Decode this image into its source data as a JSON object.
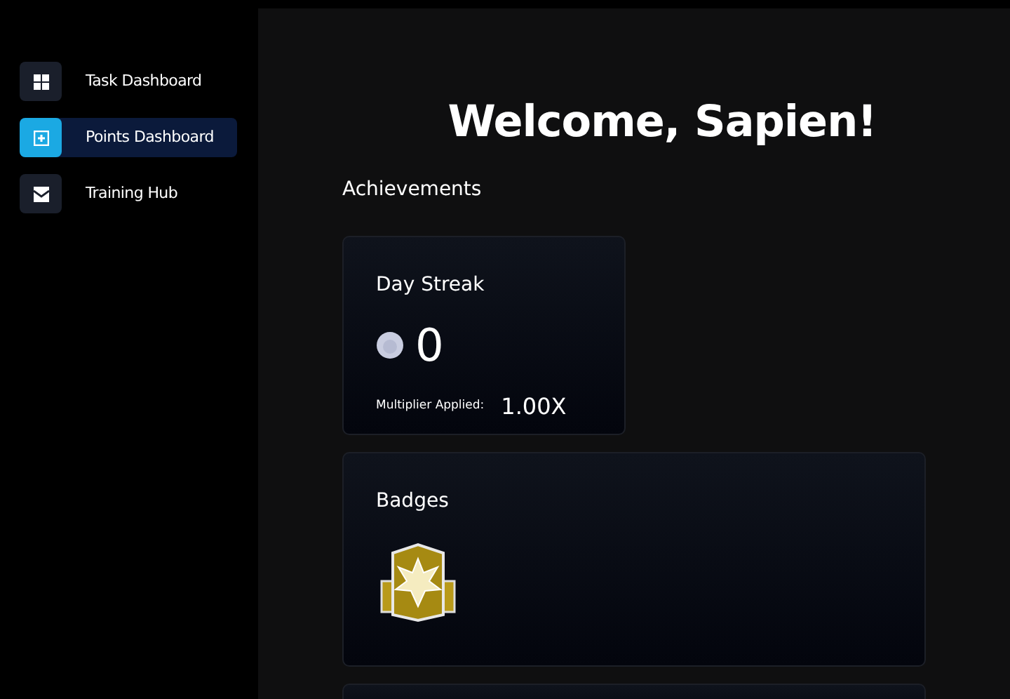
{
  "sidebar": {
    "items": [
      {
        "label": "Task Dashboard",
        "kind": "grid",
        "selected": false
      },
      {
        "label": "Points Dashboard",
        "kind": "points",
        "selected": true
      },
      {
        "label": "Training Hub",
        "kind": "training",
        "selected": false
      }
    ]
  },
  "main": {
    "title": "Welcome, Sapien!",
    "section_title": "Achievements",
    "day_streak": {
      "title": "Day Streak",
      "value": "0",
      "multiplier_label": "Multiplier Applied:",
      "multiplier_value": "1.00X"
    },
    "badges": {
      "title": "Badges"
    }
  }
}
